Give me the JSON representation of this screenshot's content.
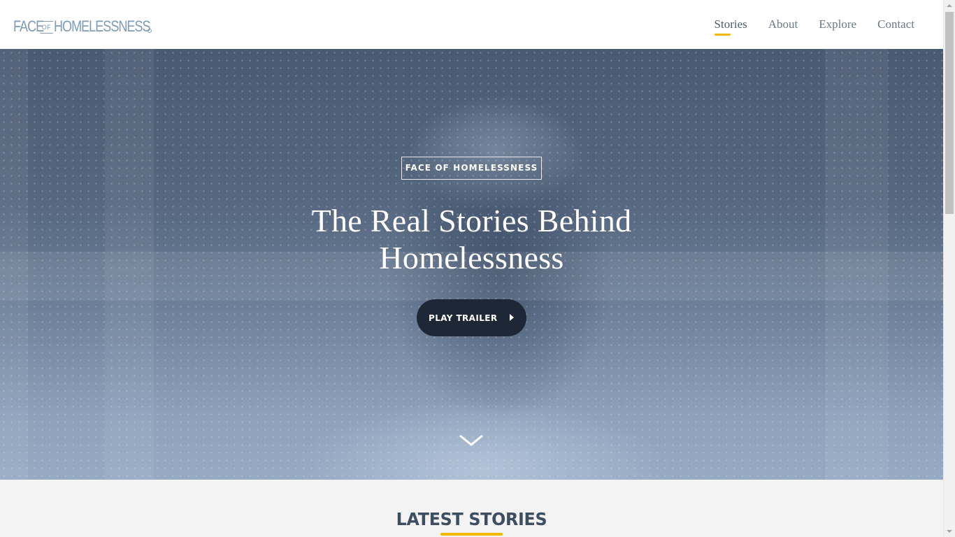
{
  "header": {
    "logo": {
      "word_face": "FACE",
      "word_of": "OF",
      "word_homelessness": "HOMELESSNESS",
      "registered_mark": "®"
    },
    "nav": [
      {
        "label": "Stories",
        "active": true
      },
      {
        "label": "About",
        "active": false
      },
      {
        "label": "Explore",
        "active": false
      },
      {
        "label": "Contact",
        "active": false
      }
    ]
  },
  "hero": {
    "badge": "FACE OF HOMELESSNESS",
    "title_line1": "The Real Stories Behind",
    "title_line2": "Homelessness",
    "play_button_label": "PLAY TRAILER",
    "play_icon": "play-icon",
    "scroll_icon": "chevron-down-icon"
  },
  "latest": {
    "title": "LATEST STORIES"
  },
  "colors": {
    "accent": "#f5b800",
    "logo": "#7f9bb5",
    "button_bg": "#1e2735",
    "heading": "#3d4e61",
    "nav_text": "#6c7a88"
  }
}
